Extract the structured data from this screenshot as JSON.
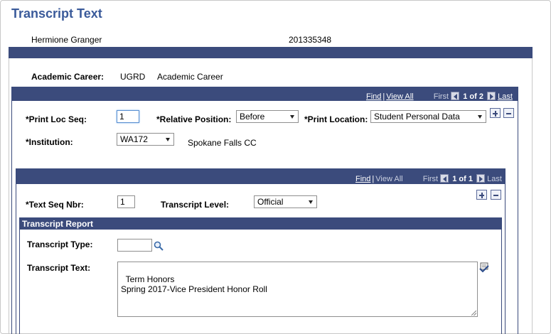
{
  "page": {
    "title": "Transcript Text"
  },
  "student": {
    "name": "Hermione Granger",
    "id": "201335348"
  },
  "career": {
    "label": "Academic Career:",
    "code": "UGRD",
    "description": "Academic Career"
  },
  "outer_scroll": {
    "find": "Find",
    "separator": "|",
    "view_all": "View All",
    "first": "First",
    "count": "1 of 2",
    "last": "Last"
  },
  "print_fields": {
    "print_loc_seq_label": "*Print Loc Seq:",
    "print_loc_seq_value": "1",
    "relative_position_label": "*Relative Position:",
    "relative_position_value": "Before",
    "print_location_label": "*Print Location:",
    "print_location_value": "Student Personal Data",
    "institution_label": "*Institution:",
    "institution_value": "WA172",
    "institution_desc": "Spokane Falls CC"
  },
  "inner_scroll": {
    "find": "Find",
    "separator": "|",
    "view_all": "View All",
    "first": "First",
    "count": "1 of 1",
    "last": "Last"
  },
  "text_fields": {
    "text_seq_label": "*Text Seq Nbr:",
    "text_seq_value": "1",
    "transcript_level_label": "Transcript Level:",
    "transcript_level_value": "Official"
  },
  "report": {
    "header": "Transcript Report",
    "type_label": "Transcript Type:",
    "type_value": "",
    "text_label": "Transcript Text:",
    "text_value": "Term Honors\nSpring 2017-Vice President Honor Roll"
  },
  "colors": {
    "title": "#3a5a9a",
    "bar": "#3b4b7c"
  },
  "icons": [
    "arrow-left-icon",
    "arrow-right-icon",
    "plus-icon",
    "minus-icon",
    "magnifier-icon",
    "spellcheck-icon"
  ]
}
